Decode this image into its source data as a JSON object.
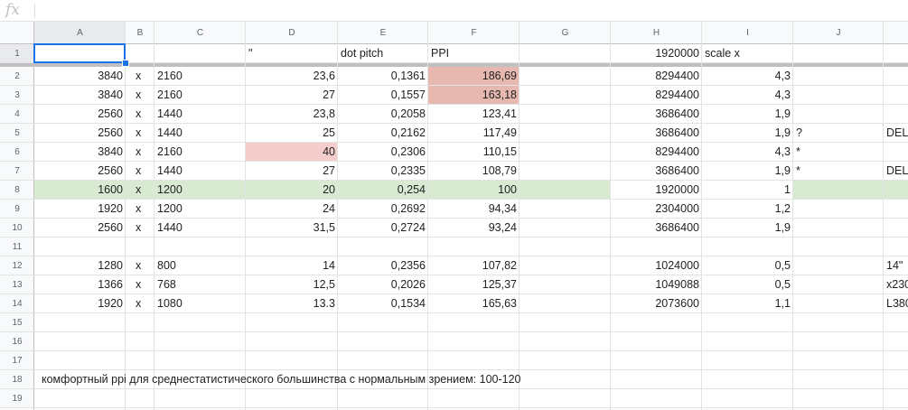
{
  "formula_bar": {
    "fx_label": "fx",
    "value": ""
  },
  "colors": {
    "header_bg": "#f8f9fa",
    "grid": "#e2e3e3",
    "pink": "#f4cccc",
    "salmon": "#e6b8af",
    "green": "#d9ead3",
    "selection": "#1a73e8"
  },
  "columns": [
    "A",
    "B",
    "C",
    "D",
    "E",
    "F",
    "G",
    "H",
    "I",
    "J",
    ""
  ],
  "rows": [
    "1",
    "2",
    "3",
    "4",
    "5",
    "6",
    "7",
    "8",
    "9",
    "10",
    "11",
    "12",
    "13",
    "14",
    "15",
    "16",
    "17",
    "18",
    "19"
  ],
  "cells": [
    {
      "r": 1,
      "c": 3,
      "v": "\""
    },
    {
      "r": 1,
      "c": 4,
      "v": "dot pitch"
    },
    {
      "r": 1,
      "c": 5,
      "v": "PPI"
    },
    {
      "r": 1,
      "c": 7,
      "v": "1920000"
    },
    {
      "r": 1,
      "c": 8,
      "v": "scale x"
    },
    {
      "r": 2,
      "c": 0,
      "v": "3840"
    },
    {
      "r": 2,
      "c": 1,
      "v": "x"
    },
    {
      "r": 2,
      "c": 2,
      "v": "2160"
    },
    {
      "r": 2,
      "c": 3,
      "v": "23,6"
    },
    {
      "r": 2,
      "c": 4,
      "v": "0,1361"
    },
    {
      "r": 2,
      "c": 5,
      "v": "186,69"
    },
    {
      "r": 2,
      "c": 7,
      "v": "8294400"
    },
    {
      "r": 2,
      "c": 8,
      "v": "4,3"
    },
    {
      "r": 3,
      "c": 0,
      "v": "3840"
    },
    {
      "r": 3,
      "c": 1,
      "v": "x"
    },
    {
      "r": 3,
      "c": 2,
      "v": "2160"
    },
    {
      "r": 3,
      "c": 3,
      "v": "27"
    },
    {
      "r": 3,
      "c": 4,
      "v": "0,1557"
    },
    {
      "r": 3,
      "c": 5,
      "v": "163,18"
    },
    {
      "r": 3,
      "c": 7,
      "v": "8294400"
    },
    {
      "r": 3,
      "c": 8,
      "v": "4,3"
    },
    {
      "r": 4,
      "c": 0,
      "v": "2560"
    },
    {
      "r": 4,
      "c": 1,
      "v": "x"
    },
    {
      "r": 4,
      "c": 2,
      "v": "1440"
    },
    {
      "r": 4,
      "c": 3,
      "v": "23,8"
    },
    {
      "r": 4,
      "c": 4,
      "v": "0,2058"
    },
    {
      "r": 4,
      "c": 5,
      "v": "123,41"
    },
    {
      "r": 4,
      "c": 7,
      "v": "3686400"
    },
    {
      "r": 4,
      "c": 8,
      "v": "1,9"
    },
    {
      "r": 5,
      "c": 0,
      "v": "2560"
    },
    {
      "r": 5,
      "c": 1,
      "v": "x"
    },
    {
      "r": 5,
      "c": 2,
      "v": "1440"
    },
    {
      "r": 5,
      "c": 3,
      "v": "25"
    },
    {
      "r": 5,
      "c": 4,
      "v": "0,2162"
    },
    {
      "r": 5,
      "c": 5,
      "v": "117,49"
    },
    {
      "r": 5,
      "c": 7,
      "v": "3686400"
    },
    {
      "r": 5,
      "c": 8,
      "v": "1,9"
    },
    {
      "r": 5,
      "c": 9,
      "v": "?"
    },
    {
      "r": 5,
      "c": 10,
      "v": "DEL"
    },
    {
      "r": 6,
      "c": 0,
      "v": "3840"
    },
    {
      "r": 6,
      "c": 1,
      "v": "x"
    },
    {
      "r": 6,
      "c": 2,
      "v": "2160"
    },
    {
      "r": 6,
      "c": 3,
      "v": "40"
    },
    {
      "r": 6,
      "c": 4,
      "v": "0,2306"
    },
    {
      "r": 6,
      "c": 5,
      "v": "110,15"
    },
    {
      "r": 6,
      "c": 7,
      "v": "8294400"
    },
    {
      "r": 6,
      "c": 8,
      "v": "4,3"
    },
    {
      "r": 6,
      "c": 9,
      "v": "*"
    },
    {
      "r": 7,
      "c": 0,
      "v": "2560"
    },
    {
      "r": 7,
      "c": 1,
      "v": "x"
    },
    {
      "r": 7,
      "c": 2,
      "v": "1440"
    },
    {
      "r": 7,
      "c": 3,
      "v": "27"
    },
    {
      "r": 7,
      "c": 4,
      "v": "0,2335"
    },
    {
      "r": 7,
      "c": 5,
      "v": "108,79"
    },
    {
      "r": 7,
      "c": 7,
      "v": "3686400"
    },
    {
      "r": 7,
      "c": 8,
      "v": "1,9"
    },
    {
      "r": 7,
      "c": 9,
      "v": "*"
    },
    {
      "r": 7,
      "c": 10,
      "v": "DEL"
    },
    {
      "r": 8,
      "c": 0,
      "v": "1600"
    },
    {
      "r": 8,
      "c": 1,
      "v": "x"
    },
    {
      "r": 8,
      "c": 2,
      "v": "1200"
    },
    {
      "r": 8,
      "c": 3,
      "v": "20"
    },
    {
      "r": 8,
      "c": 4,
      "v": "0,254"
    },
    {
      "r": 8,
      "c": 5,
      "v": "100"
    },
    {
      "r": 8,
      "c": 7,
      "v": "1920000"
    },
    {
      "r": 8,
      "c": 8,
      "v": "1"
    },
    {
      "r": 9,
      "c": 0,
      "v": "1920"
    },
    {
      "r": 9,
      "c": 1,
      "v": "x"
    },
    {
      "r": 9,
      "c": 2,
      "v": "1200"
    },
    {
      "r": 9,
      "c": 3,
      "v": "24"
    },
    {
      "r": 9,
      "c": 4,
      "v": "0,2692"
    },
    {
      "r": 9,
      "c": 5,
      "v": "94,34"
    },
    {
      "r": 9,
      "c": 7,
      "v": "2304000"
    },
    {
      "r": 9,
      "c": 8,
      "v": "1,2"
    },
    {
      "r": 10,
      "c": 0,
      "v": "2560"
    },
    {
      "r": 10,
      "c": 1,
      "v": "x"
    },
    {
      "r": 10,
      "c": 2,
      "v": "1440"
    },
    {
      "r": 10,
      "c": 3,
      "v": "31,5"
    },
    {
      "r": 10,
      "c": 4,
      "v": "0,2724"
    },
    {
      "r": 10,
      "c": 5,
      "v": "93,24"
    },
    {
      "r": 10,
      "c": 7,
      "v": "3686400"
    },
    {
      "r": 10,
      "c": 8,
      "v": "1,9"
    },
    {
      "r": 12,
      "c": 0,
      "v": "1280"
    },
    {
      "r": 12,
      "c": 1,
      "v": "x"
    },
    {
      "r": 12,
      "c": 2,
      "v": "800"
    },
    {
      "r": 12,
      "c": 3,
      "v": "14"
    },
    {
      "r": 12,
      "c": 4,
      "v": "0,2356"
    },
    {
      "r": 12,
      "c": 5,
      "v": "107,82"
    },
    {
      "r": 12,
      "c": 7,
      "v": "1024000"
    },
    {
      "r": 12,
      "c": 8,
      "v": "0,5"
    },
    {
      "r": 12,
      "c": 10,
      "v": "14\""
    },
    {
      "r": 13,
      "c": 0,
      "v": "1366"
    },
    {
      "r": 13,
      "c": 1,
      "v": "x"
    },
    {
      "r": 13,
      "c": 2,
      "v": "768"
    },
    {
      "r": 13,
      "c": 3,
      "v": "12,5"
    },
    {
      "r": 13,
      "c": 4,
      "v": "0,2026"
    },
    {
      "r": 13,
      "c": 5,
      "v": "125,37"
    },
    {
      "r": 13,
      "c": 7,
      "v": "1049088"
    },
    {
      "r": 13,
      "c": 8,
      "v": "0,5"
    },
    {
      "r": 13,
      "c": 10,
      "v": "x230"
    },
    {
      "r": 14,
      "c": 0,
      "v": "1920"
    },
    {
      "r": 14,
      "c": 1,
      "v": "x"
    },
    {
      "r": 14,
      "c": 2,
      "v": "1080"
    },
    {
      "r": 14,
      "c": 3,
      "v": "13.3"
    },
    {
      "r": 14,
      "c": 4,
      "v": "0,1534"
    },
    {
      "r": 14,
      "c": 5,
      "v": "165,63"
    },
    {
      "r": 14,
      "c": 7,
      "v": "2073600"
    },
    {
      "r": 14,
      "c": 8,
      "v": "1,1"
    },
    {
      "r": 14,
      "c": 10,
      "v": "L380"
    },
    {
      "r": 18,
      "c": 0,
      "v": "комфортный ppi для среднестатистического большинства с нормальным зрением: 100-120",
      "overflow": true
    }
  ],
  "fills": [
    {
      "r": 2,
      "c": 5,
      "color": "salmon"
    },
    {
      "r": 3,
      "c": 5,
      "color": "salmon"
    },
    {
      "r": 6,
      "c": 3,
      "color": "pink"
    },
    {
      "r": 8,
      "c": 0,
      "color": "green",
      "span": 7
    },
    {
      "r": 8,
      "c": 9,
      "color": "green",
      "span": 2
    }
  ],
  "alignment": {
    "left": [
      1,
      2,
      9,
      10
    ],
    "center": [],
    "right": [
      0,
      3,
      4,
      5,
      7,
      8
    ],
    "row1_left_cols": [
      3,
      4,
      5,
      8
    ],
    "row1_right_cols": [
      7
    ]
  },
  "selected_cell": {
    "r": 1,
    "c": 0
  }
}
